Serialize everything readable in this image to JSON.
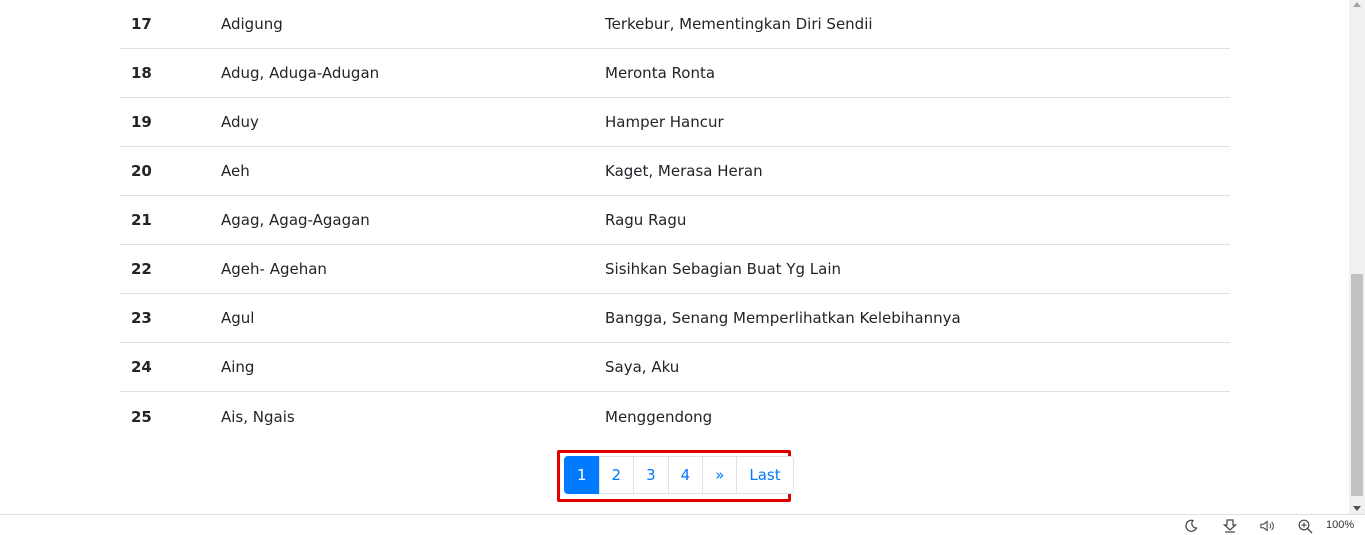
{
  "table": {
    "rows": [
      {
        "no": "17",
        "word": "Adigung",
        "meaning": "Terkebur, Mementingkan Diri Sendii"
      },
      {
        "no": "18",
        "word": "Adug, Aduga-Adugan",
        "meaning": "Meronta Ronta"
      },
      {
        "no": "19",
        "word": "Aduy",
        "meaning": "Hamper Hancur"
      },
      {
        "no": "20",
        "word": "Aeh",
        "meaning": "Kaget, Merasa Heran"
      },
      {
        "no": "21",
        "word": "Agag, Agag-Agagan",
        "meaning": "Ragu Ragu"
      },
      {
        "no": "22",
        "word": "Ageh- Agehan",
        "meaning": "Sisihkan Sebagian Buat Yg Lain"
      },
      {
        "no": "23",
        "word": "Agul",
        "meaning": "Bangga, Senang Memperlihatkan Kelebihannya"
      },
      {
        "no": "24",
        "word": "Aing",
        "meaning": "Saya, Aku"
      },
      {
        "no": "25",
        "word": "Ais, Ngais",
        "meaning": "Menggendong"
      }
    ]
  },
  "pagination": {
    "items": [
      {
        "label": "1",
        "active": true
      },
      {
        "label": "2",
        "active": false
      },
      {
        "label": "3",
        "active": false
      },
      {
        "label": "4",
        "active": false
      },
      {
        "label": "»",
        "active": false
      },
      {
        "label": "Last",
        "active": false
      }
    ]
  },
  "statusbar": {
    "icons": [
      "moon-icon",
      "download-icon",
      "speaker-icon",
      "zoom-in-icon"
    ],
    "zoom": "100%"
  },
  "colors": {
    "accent": "#007bff",
    "highlight_border": "#e00000"
  }
}
